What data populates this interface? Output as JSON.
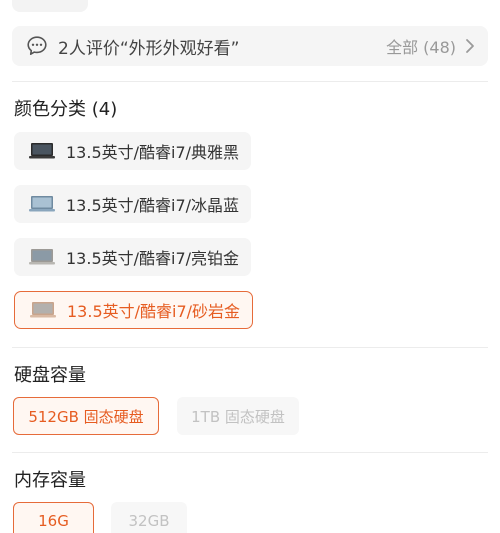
{
  "review": {
    "summary": "2人评价“外形外观好看”",
    "all_label": "全部 (48)"
  },
  "color": {
    "title": "颜色分类 (4)",
    "options": [
      {
        "label": "13.5英寸/酷睿i7/典雅黑",
        "swatch": "#2b2b2b",
        "selected": false
      },
      {
        "label": "13.5英寸/酷睿i7/冰晶蓝",
        "swatch": "#8aa6bd",
        "selected": false
      },
      {
        "label": "13.5英寸/酷睿i7/亮铂金",
        "swatch": "#b9b7b2",
        "selected": false
      },
      {
        "label": "13.5英寸/酷睿i7/砂岩金",
        "swatch": "#d9b9a3",
        "selected": true
      }
    ]
  },
  "storage": {
    "title": "硬盘容量",
    "options": [
      {
        "label": "512GB 固态硬盘",
        "state": "selected"
      },
      {
        "label": "1TB 固态硬盘",
        "state": "disabled"
      }
    ]
  },
  "memory": {
    "title": "内存容量",
    "options": [
      {
        "label": "16G",
        "state": "selected"
      },
      {
        "label": "32GB",
        "state": "disabled"
      }
    ]
  },
  "colors": {
    "accent": "#e65c21",
    "accent_border": "#e66b3a",
    "option_bg": "#f5f5f5",
    "disabled_text": "#c2c2c2"
  },
  "icons": {
    "review": "chat-bubble-icon",
    "more": "chevron-right-icon",
    "variant": "laptop-thumbnail-icon"
  }
}
